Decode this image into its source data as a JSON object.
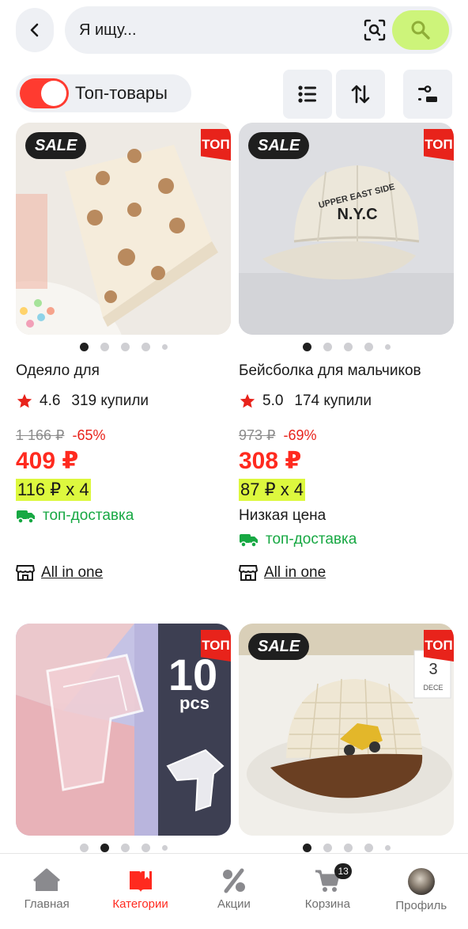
{
  "search": {
    "placeholder": "Я ищу..."
  },
  "filters": {
    "top_toggle_label": "Топ-товары",
    "top_toggle_on": true
  },
  "products": [
    {
      "sale_badge": "SALE",
      "top_badge": "ТОП",
      "title": "Одеяло для",
      "rating": "4.6",
      "bought": "319 купили",
      "old_price": "1 166 ₽",
      "discount": "-65%",
      "price": "409 ₽",
      "installment": "116 ₽ x 4",
      "delivery": "топ-доставка",
      "store": "All in one",
      "image_dots": 5,
      "active_dot": 0
    },
    {
      "sale_badge": "SALE",
      "top_badge": "ТОП",
      "title": "Бейсболка для мальчиков",
      "rating": "5.0",
      "bought": "174 купили",
      "old_price": "973 ₽",
      "discount": "-69%",
      "price": "308 ₽",
      "installment": "87 ₽ x 4",
      "tag": "Низкая цена",
      "delivery": "топ-доставка",
      "store": "All in one",
      "image_dots": 5,
      "active_dot": 0,
      "cap_text": "UPPER EAST SIDE",
      "cap_logo": "N.Y.C"
    },
    {
      "top_badge": "ТОП",
      "pack_count": "10",
      "pack_unit": "pcs",
      "image_dots": 5,
      "active_dot": 1
    },
    {
      "sale_badge": "SALE",
      "top_badge": "ТОП",
      "image_dots": 5,
      "active_dot": 0,
      "calendar_day": "3",
      "calendar_month": "DECE"
    }
  ],
  "nav": {
    "items": [
      {
        "label": "Главная",
        "icon": "home-icon"
      },
      {
        "label": "Категории",
        "icon": "catalog-book-icon"
      },
      {
        "label": "Акции",
        "icon": "percent-icon"
      },
      {
        "label": "Корзина",
        "icon": "cart-icon"
      },
      {
        "label": "Профиль",
        "icon": "avatar"
      }
    ],
    "active_index": 1,
    "cart_count": "13"
  },
  "colors": {
    "accent_red": "#ff2a1f",
    "search_button": "#cdf47a",
    "installment_highlight": "#ddf83e",
    "delivery_green": "#17a843"
  }
}
